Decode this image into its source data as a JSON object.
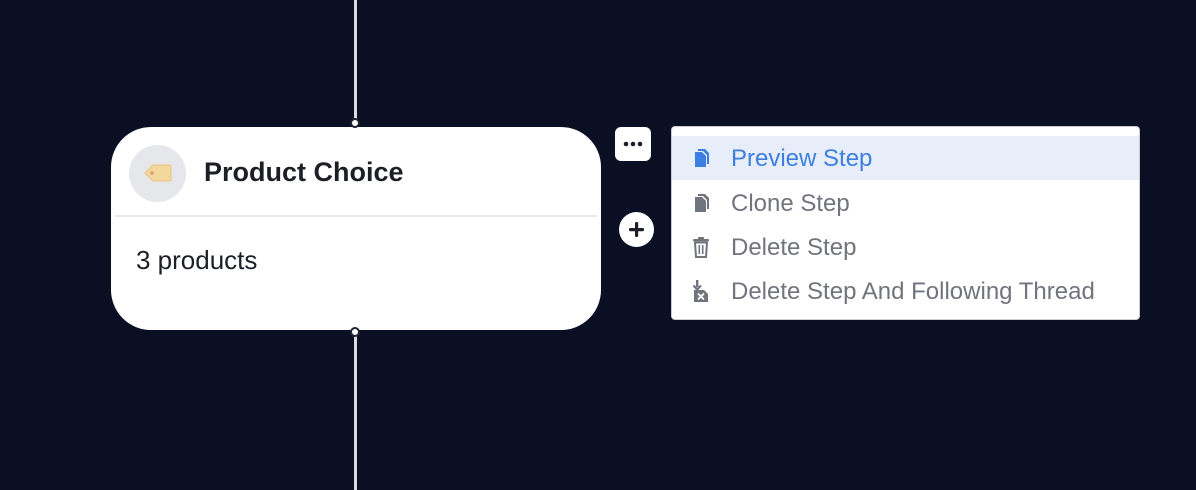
{
  "node": {
    "title": "Product Choice",
    "summary": "3 products",
    "icon": "price-tag-icon"
  },
  "controls": {
    "more_icon": "ellipsis-icon",
    "add_icon": "plus-icon"
  },
  "menu": {
    "items": [
      {
        "label": "Preview Step",
        "icon": "copy-icon",
        "highlighted": true
      },
      {
        "label": "Clone Step",
        "icon": "copy-icon",
        "highlighted": false
      },
      {
        "label": "Delete Step",
        "icon": "trash-icon",
        "highlighted": false
      },
      {
        "label": "Delete Step And Following Thread",
        "icon": "delete-thread-icon",
        "highlighted": false
      }
    ]
  },
  "colors": {
    "canvas_background": "#0a0f24",
    "menu_highlight": "#e8eef9",
    "accent": "#3d7fe0",
    "menu_text": "#70747d"
  }
}
